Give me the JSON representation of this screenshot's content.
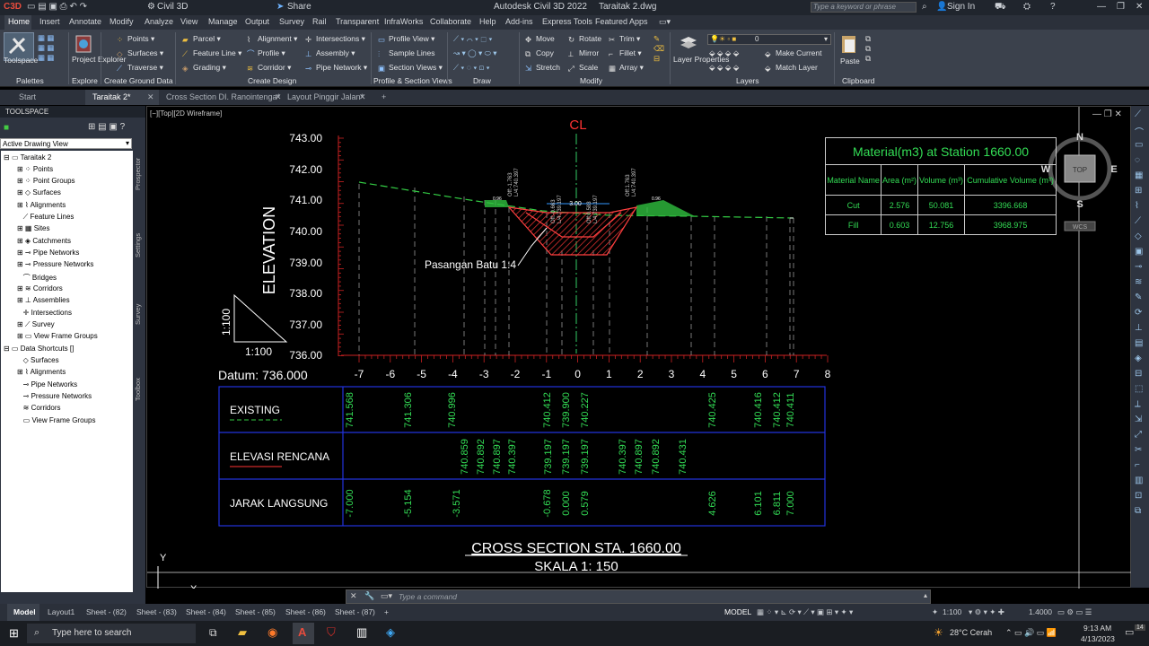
{
  "title": {
    "app": "Autodesk Civil 3D 2022",
    "file": "Taraitak 2.dwg",
    "workspace": "Civil 3D",
    "share": "Share",
    "search_placeholder": "Type a keyword or phrase",
    "sign_in": "Sign In"
  },
  "menu": [
    "Home",
    "Insert",
    "Annotate",
    "Modify",
    "Analyze",
    "View",
    "Manage",
    "Output",
    "Survey",
    "Rail",
    "Transparent",
    "InfraWorks",
    "Collaborate",
    "Help",
    "Add-ins",
    "Express Tools",
    "Featured Apps"
  ],
  "ribbon": {
    "toolspace": "Toolspace",
    "project_explorer": "Project Explorer",
    "points": "Points",
    "surfaces": "Surfaces",
    "traverse": "Traverse",
    "parcel": "Parcel",
    "feature_line": "Feature Line",
    "grading": "Grading",
    "alignment": "Alignment",
    "profile": "Profile",
    "corridor": "Corridor",
    "intersections": "Intersections",
    "assembly": "Assembly",
    "pipe_network": "Pipe Network",
    "profile_view": "Profile View",
    "sample_lines": "Sample Lines",
    "section_views": "Section Views",
    "move": "Move",
    "copy": "Copy",
    "stretch": "Stretch",
    "rotate": "Rotate",
    "mirror": "Mirror",
    "scale": "Scale",
    "trim": "Trim",
    "fillet": "Fillet",
    "array": "Array",
    "layer_properties": "Layer Properties",
    "layer_value": "0",
    "make_current": "Make Current",
    "match_layer": "Match Layer",
    "paste": "Paste",
    "groups": {
      "palettes": "Palettes",
      "explore": "Explore",
      "create_ground_data": "Create Ground Data",
      "create_design": "Create Design",
      "profile_section_views": "Profile & Section Views",
      "draw": "Draw",
      "modify": "Modify",
      "layers": "Layers",
      "clipboard": "Clipboard"
    }
  },
  "doc_tabs": [
    "Start",
    "Taraitak 2*",
    "Cross Section DI. Ranointenga*",
    "Layout Pinggir Jalan*"
  ],
  "toolspace": {
    "header": "TOOLSPACE",
    "view": "Active Drawing View",
    "side_tabs": [
      "Prospector",
      "Settings",
      "Survey",
      "Toolbox"
    ],
    "tree": {
      "root": "Taraitak 2",
      "items": [
        "Points",
        "Point Groups",
        "Surfaces",
        "Alignments",
        "Feature Lines",
        "Sites",
        "Catchments",
        "Pipe Networks",
        "Pressure Networks",
        "Bridges",
        "Corridors",
        "Assemblies",
        "Intersections",
        "Survey",
        "View Frame Groups"
      ],
      "shortcuts": "Data Shortcuts []",
      "shortcut_items": [
        "Surfaces",
        "Alignments",
        "Pipe Networks",
        "Pressure Networks",
        "Corridors",
        "View Frame Groups"
      ]
    }
  },
  "viewport": {
    "label": "[−][Top][2D Wireframe]",
    "compass": {
      "n": "N",
      "s": "S",
      "e": "E",
      "w": "W",
      "top": "TOP",
      "wcs": "WCS"
    },
    "ucs_x": "X",
    "ucs_y": "Y"
  },
  "section": {
    "cl": "CL",
    "elevation_label": "ELEVATION",
    "elevations": [
      "743.00",
      "742.00",
      "741.00",
      "740.00",
      "739.00",
      "738.00",
      "737.00",
      "736.00"
    ],
    "offsets": [
      "-7",
      "-6",
      "-5",
      "-4",
      "-3",
      "-2",
      "-1",
      "0",
      "1",
      "2",
      "3",
      "4",
      "5",
      "6",
      "7",
      "8"
    ],
    "datum": "Datum: 736.000",
    "scale_v": "1:100",
    "scale_h": "1:100",
    "annotation": "Pasangan Batu 1:4",
    "top_width": "3.00",
    "cut_label": "0.96",
    "vertical_labels": [
      "Off:-1.763",
      "L/4:740.397",
      "Off:-0.663",
      "L/4:739.197",
      "Off:0.583",
      "L/4:739.197",
      "Off:1.763",
      "L/4:740.397"
    ],
    "title": "CROSS SECTION STA. 1660.00",
    "subtitle": "SKALA 1: 150"
  },
  "band_table": {
    "rows": [
      {
        "label": "EXISTING",
        "values": [
          "741.568",
          "741.306",
          "740.996",
          "740.412",
          "739.900",
          "740.227",
          "740.425",
          "740.416",
          "740.412",
          "740.411"
        ]
      },
      {
        "label": "ELEVASI RENCANA",
        "values": [
          "740.859",
          "740.892",
          "740.897",
          "740.397",
          "739.197",
          "739.197",
          "739.197",
          "740.397",
          "740.897",
          "740.892",
          "740.431"
        ]
      },
      {
        "label": "JARAK LANGSUNG",
        "values": [
          "-7.000",
          "-5.154",
          "-3.571",
          "-0.678",
          "0.000",
          "0.579",
          "4.626",
          "6.101",
          "6.811",
          "7.000"
        ]
      }
    ]
  },
  "material_table": {
    "title": "Material(m3) at Station 1660.00",
    "headers": [
      "Material Name",
      "Area (m²)",
      "Volume (m³)",
      "Cumulative Volume (m³)"
    ],
    "rows": [
      [
        "Cut",
        "2.576",
        "50.081",
        "3396.668"
      ],
      [
        "Fill",
        "0.603",
        "12.756",
        "3968.975"
      ]
    ]
  },
  "command": {
    "placeholder": "Type a command"
  },
  "layout_tabs": [
    "Model",
    "Layout1",
    "Sheet - (82)",
    "Sheet - (83)",
    "Sheet - (84)",
    "Sheet - (85)",
    "Sheet - (86)",
    "Sheet - (87)"
  ],
  "status": {
    "model": "MODEL",
    "scale": "1:100",
    "value": "1.4000"
  },
  "taskbar": {
    "search": "Type here to search",
    "weather": "28°C Cerah",
    "time": "9:13 AM",
    "date": "4/13/2023",
    "notifications": "14"
  }
}
